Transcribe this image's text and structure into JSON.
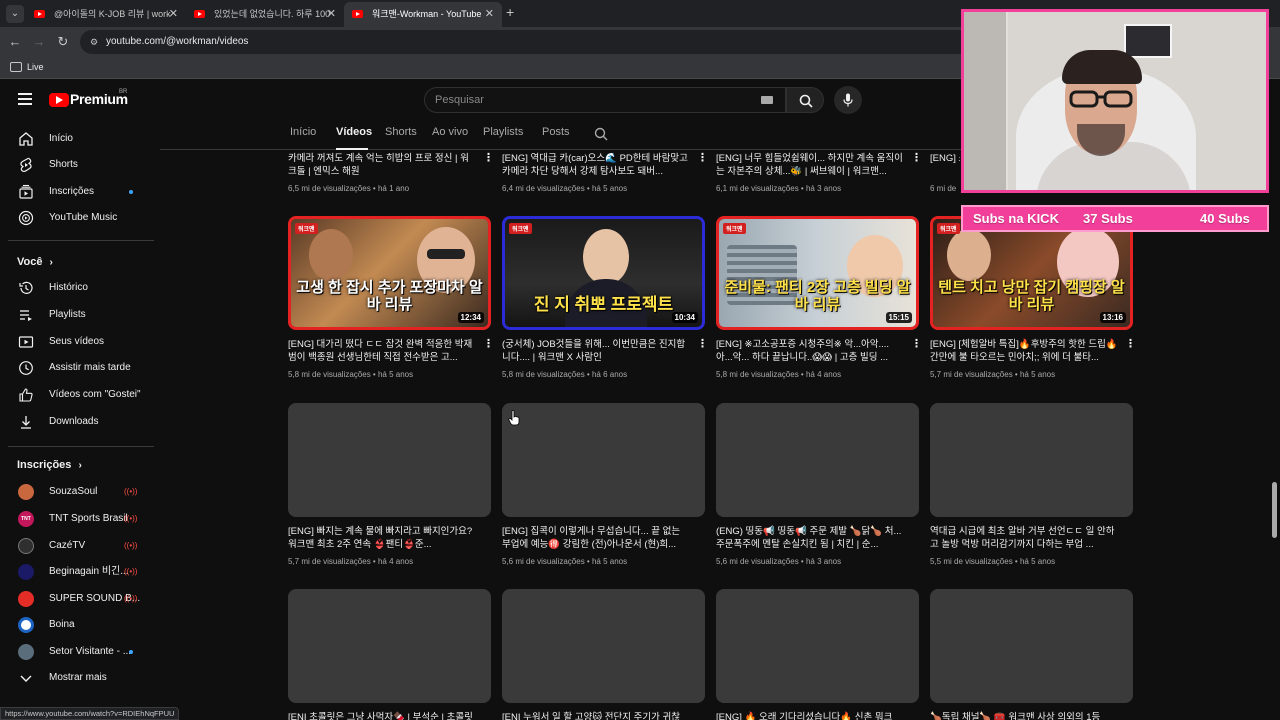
{
  "browser": {
    "tabs": [
      {
        "title": "@아이돌의 K-JOB 리뷰 | work",
        "active": false
      },
      {
        "title": "있었는데 없었습니다. 하루 100",
        "active": false
      },
      {
        "title": "워크맨-Workman - YouTube",
        "active": true
      }
    ],
    "url": "youtube.com/@workman/videos",
    "bookmark": "Live",
    "status_url": "https://www.youtube.com/watch?v=RDIEhNqFPUU"
  },
  "header": {
    "logo_text": "Premium",
    "logo_region": "BR",
    "search_placeholder": "Pesquisar"
  },
  "sidebar": {
    "main": [
      {
        "label": "Início",
        "icon": "home-icon"
      },
      {
        "label": "Shorts",
        "icon": "shorts-icon"
      },
      {
        "label": "Inscrições",
        "icon": "subscriptions-icon",
        "dot": true
      },
      {
        "label": "YouTube Music",
        "icon": "music-icon"
      }
    ],
    "you_title": "Você",
    "you": [
      {
        "label": "Histórico",
        "icon": "history-icon"
      },
      {
        "label": "Playlists",
        "icon": "playlists-icon"
      },
      {
        "label": "Seus vídeos",
        "icon": "your-videos-icon"
      },
      {
        "label": "Assistir mais tarde",
        "icon": "watch-later-icon"
      },
      {
        "label": "Vídeos com \"Gostei\"",
        "icon": "liked-icon"
      },
      {
        "label": "Downloads",
        "icon": "downloads-icon"
      }
    ],
    "subs_title": "Inscrições",
    "subscriptions": [
      {
        "label": "SouzaSoul",
        "live": true,
        "color": "#c9673f"
      },
      {
        "label": "TNT Sports Brasil",
        "live": true,
        "color": "#c2185b"
      },
      {
        "label": "CazéTV",
        "live": true,
        "color": "#2f2f2f"
      },
      {
        "label": "Beginagain 비긴...",
        "live": true,
        "color": "#1a1a66"
      },
      {
        "label": "SUPER SOUND B...",
        "live": true,
        "color": "#e52d27"
      },
      {
        "label": "Boina",
        "live": false,
        "color": "#1d64c2"
      },
      {
        "label": "Setor Visitante - ...",
        "live": false,
        "dot": true,
        "color": "#5a6d7a"
      }
    ],
    "more_label": "Mostrar mais"
  },
  "channel_tabs": [
    "Início",
    "Vídeos",
    "Shorts",
    "Ao vivo",
    "Playlists",
    "Posts"
  ],
  "channel_tab_active": "Vídeos",
  "videos_row0": [
    {
      "title": "카메라 꺼져도 계속 억는 히밥의 프로 정신 | 워크돌 | 엔믹스 해원",
      "meta": "6,5 mi de visualizações • há 1 ano"
    },
    {
      "title": "[ENG] 역대급 카(car)오스🌊 PD한테 바람맞고 카메라 차단 당해서 강제 탐사보도 돼버...",
      "meta": "6,4 mi de visualizações • há 5 anos"
    },
    {
      "title": "[ENG] 너무 힘들었쉽웨이... 하지만 계속 움직이는 자본주의 상체...🐝 | 써브웨이 | 워크맨...",
      "meta": "6,1 mi de visualizações • há 3 anos"
    },
    {
      "title": "[ENG] 쇼 박럭 넘",
      "meta": "6 mi de"
    }
  ],
  "videos_row1": [
    {
      "title": "[ENG] 대가리 떴다 ㄷㄷ 잡것 완벽 적응한 박재범이 백종원 선생님한테 직접 전수받은 고...",
      "meta": "5,8 mi de visualizações • há 5 anos",
      "duration": "12:34",
      "caption": "고생 한 잡시 추가 포장마차 알바 리뷰"
    },
    {
      "title": "(궁서체) JOB것들을 위해... 이번만큼은 진지합니다.... | 워크맨 X 사람인",
      "meta": "5,8 mi de visualizações • há 6 anos",
      "duration": "10:34",
      "caption": "진 지 취뽀 프로젝트"
    },
    {
      "title": "[ENG] ※고소공포증 시청주의※ 악...아악.... 아...악... 하다 끝납니다..😱😱 | 고층 빌딩 ...",
      "meta": "5,8 mi de visualizações • há 4 anos",
      "duration": "15:15",
      "caption": "준비물: 팬티 2장 고층 빌딩 알바 리뷰"
    },
    {
      "title": "[ENG] [체험알바 특집]🔥후방주의 핫한 드립🔥 간만에 불 타오르는 민아치;; 위에 더 불타...",
      "meta": "5,7 mi de visualizações • há 5 anos",
      "duration": "13:16",
      "caption": "텐트 치고 낭만 잡기 캠핑장 알바 리뷰"
    }
  ],
  "videos_row2": [
    {
      "title": "[ENG] 빠지는 계속 물에 빠지라고 빠지인가요? 워크맨 최초 2주 연속 👙팬티👙준...",
      "meta": "5,7 mi de visualizações • há 4 anos"
    },
    {
      "title": "[ENG] 집콕이 이렇게나 무섭습니다... 끝 없는 부업에 예능🉐 강림한 (전)아나운서 (현)희...",
      "meta": "5,6 mi de visualizações • há 5 anos"
    },
    {
      "title": "(ENG) 띵동📢 띵동📢 주문 제발 🍗닭🍗 처... 주문폭주에 멘탈 손실치킨 됨 | 치킨 | 순...",
      "meta": "5,6 mi de visualizações • há 3 anos"
    },
    {
      "title": "역대급 시급에 최초 알바 거부 선언ㄷㄷ 일 안하고 놀방 먹방 머리감기까지 다하는 부업 ...",
      "meta": "5,5 mi de visualizações • há 5 anos"
    }
  ],
  "videos_row3": [
    {
      "title": "[ENI 초콜릿은 그냥 사먹자🍫 | 부석순 | 초콜릿"
    },
    {
      "title": "[ENI 누워서 일 할 고양🐱 전단지 주기가 귀찮"
    },
    {
      "title": "[ENG] 🔥 오래 기다리셨습니다🔥 신촌 뭐크"
    },
    {
      "title": "🍗독립 채널🍗 🧰 워크맨 사상 의외의 1등"
    }
  ],
  "overlay": {
    "subs_left": "Subs na KICK",
    "subs_mid": "37 Subs",
    "subs_right": "40 Subs"
  },
  "colors": {
    "accent": "#ff0000",
    "overlay_pink": "#f23f9a",
    "live_red": "#ff4e45",
    "link_blue": "#3ea6ff"
  }
}
